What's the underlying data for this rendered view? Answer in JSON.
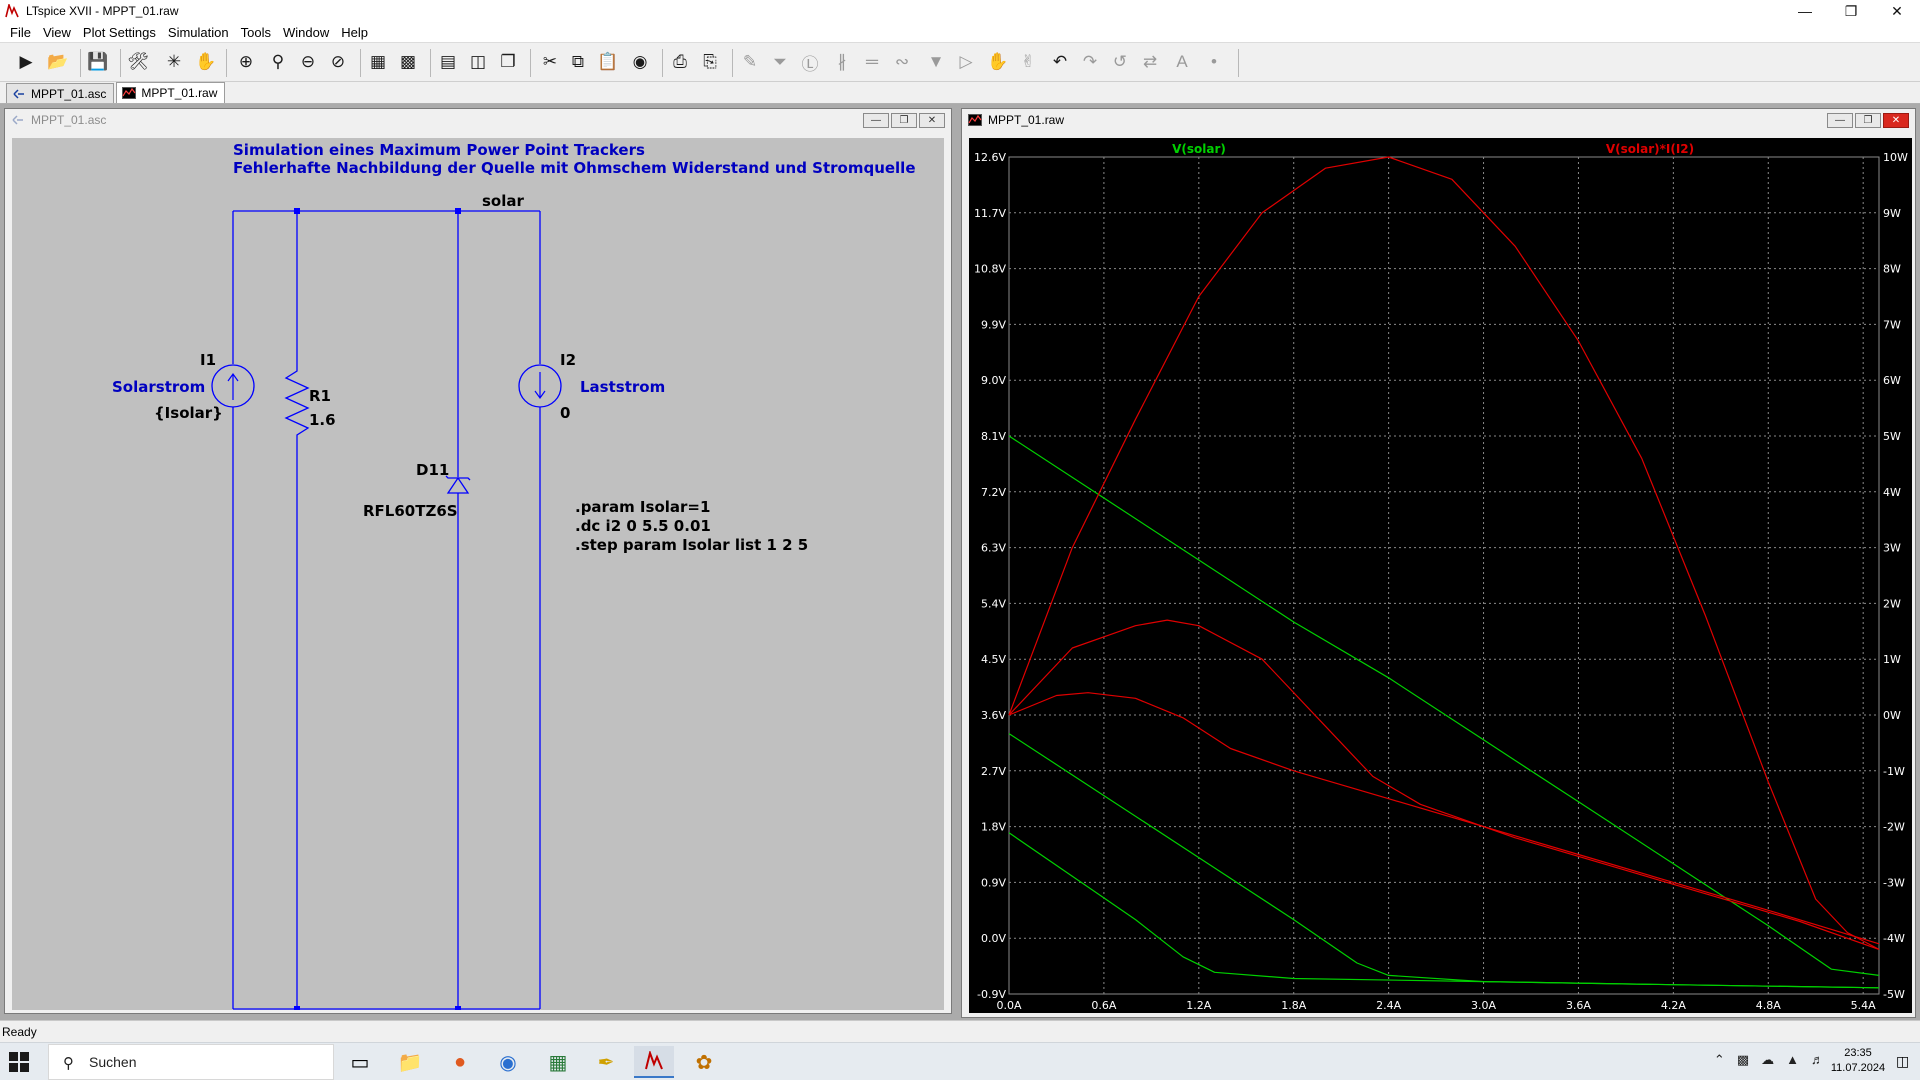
{
  "window": {
    "title": "LTspice XVII - MPPT_01.raw"
  },
  "menu": [
    "File",
    "View",
    "Plot Settings",
    "Simulation",
    "Tools",
    "Window",
    "Help"
  ],
  "tabs": [
    {
      "label": "MPPT_01.asc",
      "icon": "schematic-icon"
    },
    {
      "label": "MPPT_01.raw",
      "icon": "waveform-icon"
    }
  ],
  "schematic": {
    "title": "MPPT_01.asc",
    "heading1": "Simulation eines Maximum Power Point Trackers",
    "heading2": "Fehlerhafte Nachbildung der Quelle mit Ohmschem Widerstand und Stromquelle",
    "net_label": "solar",
    "i1": {
      "name": "I1",
      "label": "Solarstrom",
      "value": "{Isolar}"
    },
    "r1": {
      "name": "R1",
      "value": "1.6"
    },
    "d11": {
      "name": "D11",
      "model": "RFL60TZ6S"
    },
    "i2": {
      "name": "I2",
      "label": "Laststrom",
      "value": "0"
    },
    "directives": [
      ".param Isolar=1",
      ".dc i2 0 5.5 0.01",
      ".step param Isolar list 1 2 5"
    ],
    "colors": {
      "wire": "#0000ff",
      "text": "#0000c0",
      "bg": "#c0c0c0"
    }
  },
  "plot": {
    "title": "MPPT_01.raw",
    "trace_left_label": "V(solar)",
    "trace_right_label": "V(solar)*I(I2)",
    "colors": {
      "voltage": "#00d000",
      "power": "#e00000",
      "grid": "#8a8a8a",
      "bg": "#000000",
      "axis_text": "#ffffff"
    },
    "y_left_ticks": [
      "12.6V",
      "11.7V",
      "10.8V",
      "9.9V",
      "9.0V",
      "8.1V",
      "7.2V",
      "6.3V",
      "5.4V",
      "4.5V",
      "3.6V",
      "2.7V",
      "1.8V",
      "0.9V",
      "0.0V",
      "-0.9V"
    ],
    "y_right_ticks": [
      "10W",
      "9W",
      "8W",
      "7W",
      "6W",
      "5W",
      "4W",
      "3W",
      "2W",
      "1W",
      "0W",
      "-1W",
      "-2W",
      "-3W",
      "-4W",
      "-5W"
    ],
    "x_ticks": [
      "0.0A",
      "0.6A",
      "1.2A",
      "1.8A",
      "2.4A",
      "3.0A",
      "3.6A",
      "4.2A",
      "4.8A",
      "5.4A"
    ]
  },
  "chart_data": {
    "type": "line",
    "xlabel": "",
    "ylabel": "",
    "xlim": [
      0,
      5.5
    ],
    "ylim": [
      -0.9,
      12.6
    ],
    "y2lim": [
      -5,
      10
    ],
    "grid": true,
    "legend": "top",
    "series": [
      {
        "axis": "left",
        "color": "#00d000",
        "x": [
          0,
          0.6,
          1.2,
          1.8,
          2.4,
          3.0,
          3.6,
          4.2,
          4.8,
          5.2,
          5.5
        ],
        "y": [
          8.1,
          7.1,
          6.1,
          5.1,
          4.2,
          3.2,
          2.2,
          1.2,
          0.2,
          -0.5,
          -0.6
        ]
      },
      {
        "axis": "left",
        "color": "#00d000",
        "x": [
          0,
          0.6,
          1.2,
          1.8,
          2.2,
          2.4,
          3.0,
          4.2,
          5.5
        ],
        "y": [
          3.3,
          2.3,
          1.3,
          0.3,
          -0.4,
          -0.6,
          -0.7,
          -0.75,
          -0.8
        ]
      },
      {
        "axis": "left",
        "color": "#00d000",
        "x": [
          0,
          0.4,
          0.8,
          1.1,
          1.3,
          1.8,
          3.0,
          4.2,
          5.5
        ],
        "y": [
          1.7,
          1.0,
          0.3,
          -0.3,
          -0.55,
          -0.65,
          -0.7,
          -0.75,
          -0.8
        ]
      },
      {
        "axis": "right",
        "color": "#e00000",
        "x": [
          0,
          0.4,
          0.8,
          1.2,
          1.6,
          2.0,
          2.4,
          2.8,
          3.2,
          3.6,
          4.0,
          4.4,
          4.8,
          5.1,
          5.3,
          5.5
        ],
        "y": [
          0,
          3.0,
          5.3,
          7.5,
          9.0,
          9.8,
          10.0,
          9.6,
          8.4,
          6.7,
          4.6,
          1.8,
          -1.2,
          -3.3,
          -3.9,
          -4.2
        ]
      },
      {
        "axis": "right",
        "color": "#e00000",
        "x": [
          0,
          0.4,
          0.8,
          1.0,
          1.2,
          1.6,
          2.0,
          2.3,
          2.6,
          3.2,
          3.8,
          4.4,
          5.0,
          5.5
        ],
        "y": [
          0,
          1.2,
          1.6,
          1.7,
          1.6,
          1.0,
          -0.2,
          -1.1,
          -1.6,
          -2.2,
          -2.7,
          -3.2,
          -3.7,
          -4.2
        ]
      },
      {
        "axis": "right",
        "color": "#e00000",
        "x": [
          0,
          0.3,
          0.5,
          0.8,
          1.1,
          1.4,
          1.8,
          2.4,
          3.0,
          3.6,
          4.2,
          4.8,
          5.5
        ],
        "y": [
          0,
          0.35,
          0.4,
          0.3,
          -0.05,
          -0.6,
          -1.0,
          -1.5,
          -2.0,
          -2.5,
          -3.0,
          -3.5,
          -4.1
        ]
      }
    ]
  },
  "status": "Ready",
  "taskbar": {
    "search_placeholder": "Suchen",
    "time": "23:35",
    "date": "11.07.2024"
  }
}
